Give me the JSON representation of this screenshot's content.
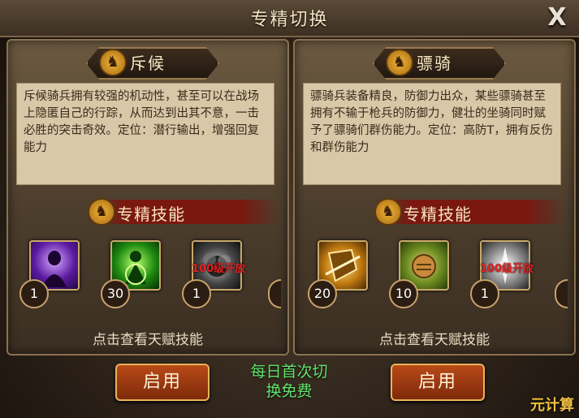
{
  "title": "专精切换",
  "close_label": "X",
  "left": {
    "class_name": "斥候",
    "description": "斥候骑兵拥有较强的机动性，甚至可以在战场上隐匿自己的行踪，从而达到出其不意，一击必胜的突击奇效。定位：潜行输出，增强回复能力",
    "skills_header": "专精技能",
    "skills": [
      {
        "icon": "shadow-figure-icon",
        "level": "1"
      },
      {
        "icon": "green-aura-icon",
        "level": "30"
      },
      {
        "icon": "smoke-skill-icon",
        "level": "1",
        "unlock": "100级开放"
      }
    ],
    "talent_link": "点击查看天赋技能",
    "button": "启用"
  },
  "right": {
    "class_name": "骠骑",
    "description": "骠骑兵装备精良，防御力出众，某些骠骑甚至拥有不输于枪兵的防御力，健壮的坐骑同时赋予了骠骑们群伤能力。定位：高防T，拥有反伤和群伤能力",
    "skills_header": "专精技能",
    "skills": [
      {
        "icon": "golden-shield-icon",
        "level": "20"
      },
      {
        "icon": "fist-strike-icon",
        "level": "10"
      },
      {
        "icon": "white-burst-icon",
        "level": "1",
        "unlock": "100级开放"
      }
    ],
    "talent_link": "点击查看天赋技能",
    "button": "启用"
  },
  "free_notice": "每日首次切换免费",
  "watermark": "元计算",
  "colors": {
    "accent": "#c8a36a",
    "button": "#9a3a12",
    "free_text": "#62e36a",
    "locked": "#e32020"
  }
}
